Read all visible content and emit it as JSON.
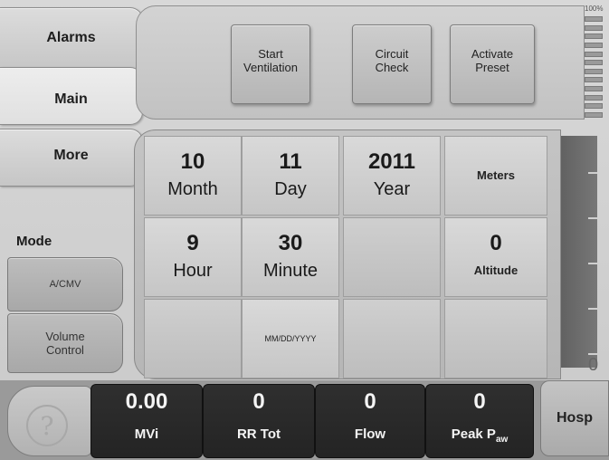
{
  "tabs": {
    "alarms": "Alarms",
    "main": "Main",
    "more": "More"
  },
  "mode": {
    "label": "Mode",
    "ventilation_mode": "A/CMV",
    "control_type": "Volume Control"
  },
  "top_buttons": {
    "start_ventilation": "Start Ventilation",
    "circuit_check": "Circuit Check",
    "activate_preset": "Activate Preset"
  },
  "level_meter": {
    "label": "100%"
  },
  "settings": {
    "month": {
      "value": "10",
      "label": "Month"
    },
    "day": {
      "value": "11",
      "label": "Day"
    },
    "year": {
      "value": "2011",
      "label": "Year"
    },
    "units": "Meters",
    "hour": {
      "value": "9",
      "label": "Hour"
    },
    "minute": {
      "value": "30",
      "label": "Minute"
    },
    "altitude": {
      "value": "0",
      "label": "Altitude"
    },
    "date_format": "MM/DD/YYYY"
  },
  "scale": {
    "zero_label": "0"
  },
  "vitals": {
    "mvi": {
      "value": "0.00",
      "label": "MVi"
    },
    "rr_tot": {
      "value": "0",
      "label": "RR Tot"
    },
    "flow": {
      "value": "0",
      "label": "Flow"
    },
    "peak_paw": {
      "value": "0",
      "label": "Peak P",
      "label_sub": "aw"
    }
  },
  "help": {
    "icon": "?"
  },
  "hosp_button": "Hosp"
}
